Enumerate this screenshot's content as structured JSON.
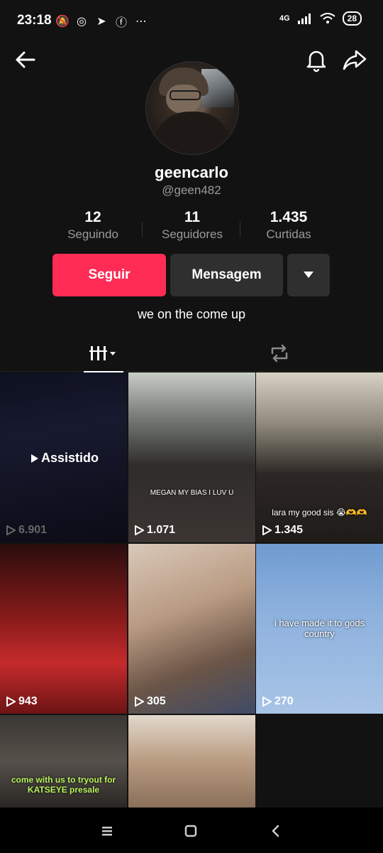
{
  "status_bar": {
    "time": "23:18",
    "network": "4G",
    "battery": "28",
    "icons": [
      "mute-icon",
      "whatsapp-icon",
      "telegram-icon",
      "facebook-icon",
      "more-dots-icon"
    ]
  },
  "profile": {
    "display_name": "geencarlo",
    "handle": "@geen482",
    "bio": "we on the come up"
  },
  "stats": [
    {
      "value": "12",
      "label": "Seguindo"
    },
    {
      "value": "11",
      "label": "Seguidores"
    },
    {
      "value": "1.435",
      "label": "Curtidas"
    }
  ],
  "actions": {
    "follow_label": "Seguir",
    "message_label": "Mensagem"
  },
  "videos": [
    {
      "views": "6.901",
      "watched_label": "Assistido",
      "caption": ""
    },
    {
      "views": "1.071",
      "caption": "MEGAN MY BIAS I LUV U"
    },
    {
      "views": "1.345",
      "caption": "lara my good sis 😭🫶🫶"
    },
    {
      "views": "943",
      "caption": ""
    },
    {
      "views": "305",
      "caption": ""
    },
    {
      "views": "270",
      "caption": "i have made it to gods country"
    },
    {
      "views": "",
      "caption": "come with us to tryout for KATSEYE presale"
    },
    {
      "views": "",
      "caption": ""
    }
  ],
  "colors": {
    "accent": "#fe2c55",
    "background": "#121212",
    "button_secondary": "#2f2f2f"
  }
}
